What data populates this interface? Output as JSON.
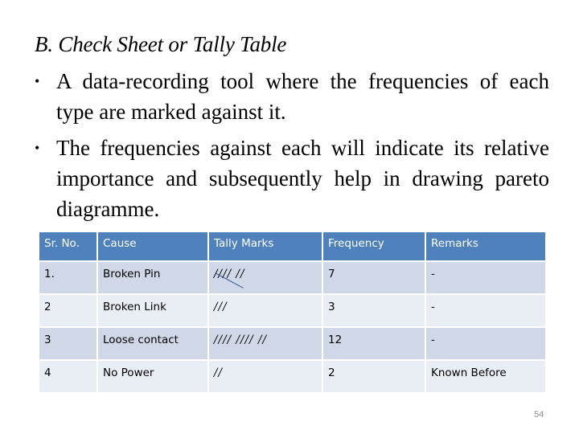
{
  "slide": {
    "title": "B. Check Sheet or Tally Table",
    "bullets": [
      "A data-recording tool where the frequencies of each type are marked against it.",
      "The frequencies against each will indicate its relative importance and subsequently help in drawing pareto diagramme."
    ],
    "page_number": "54"
  },
  "table": {
    "headers": [
      "Sr. No.",
      "Cause",
      "Tally Marks",
      "Frequency",
      "Remarks"
    ],
    "rows": [
      {
        "sr": "1.",
        "cause": "Broken Pin",
        "tally": "//// //",
        "frequency": "7",
        "remarks": "-"
      },
      {
        "sr": "2",
        "cause": "Broken Link",
        "tally": "///",
        "frequency": "3",
        "remarks": "-"
      },
      {
        "sr": "3",
        "cause": "Loose contact",
        "tally": "//// //// //",
        "frequency": "12",
        "remarks": "-"
      },
      {
        "sr": "4",
        "cause": "No Power",
        "tally": "//",
        "frequency": "2",
        "remarks": "Known Before"
      }
    ],
    "colors": {
      "header": "#4f81bd",
      "row_odd": "#d0d8e8",
      "row_even": "#e9edf4"
    }
  }
}
